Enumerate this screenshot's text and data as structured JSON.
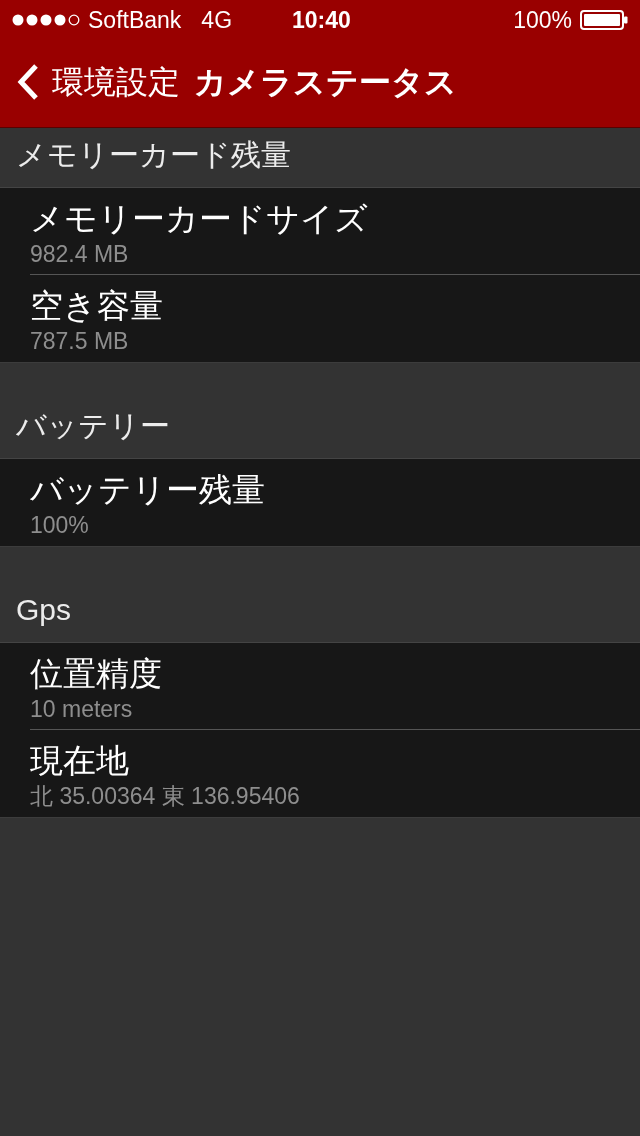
{
  "status_bar": {
    "carrier": "SoftBank",
    "network": "4G",
    "time": "10:40",
    "battery": "100%"
  },
  "nav_bar": {
    "back_label": "環境設定",
    "title": "カメラステータス"
  },
  "sections": [
    {
      "header": "メモリーカード残量",
      "rows": [
        {
          "title": "メモリーカードサイズ",
          "value": "982.4 MB"
        },
        {
          "title": "空き容量",
          "value": "787.5 MB"
        }
      ]
    },
    {
      "header": "バッテリー",
      "rows": [
        {
          "title": "バッテリー残量",
          "value": "100%"
        }
      ]
    },
    {
      "header": "Gps",
      "rows": [
        {
          "title": "位置精度",
          "value": "10 meters"
        },
        {
          "title": "現在地",
          "value": "北 35.00364 東 136.95406"
        }
      ]
    }
  ]
}
